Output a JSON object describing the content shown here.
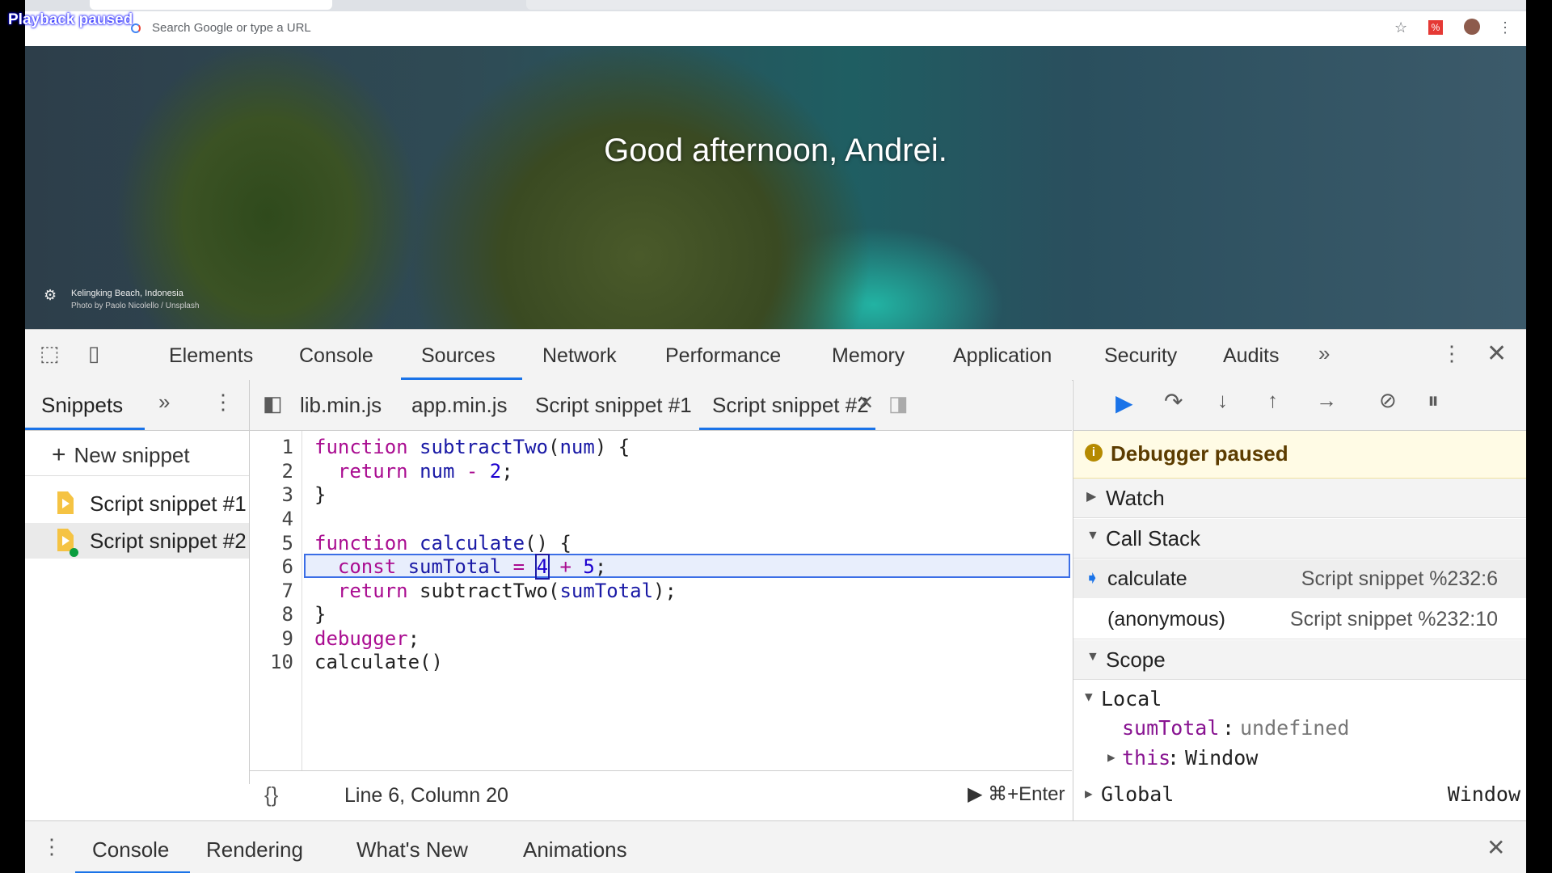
{
  "overlay": {
    "playback": "Playback paused"
  },
  "browser": {
    "url_placeholder": "Search Google or type a URL"
  },
  "hero": {
    "greeting": "Good afternoon, Andrei.",
    "location": "Kelingking Beach, Indonesia",
    "credit": "Photo by Paolo Nicolello / Unsplash"
  },
  "devtools": {
    "tabs": [
      "Elements",
      "Console",
      "Sources",
      "Network",
      "Performance",
      "Memory",
      "Application",
      "Security",
      "Audits"
    ],
    "active_tab": "Sources"
  },
  "navigator": {
    "tab": "Snippets",
    "new_snippet": "New snippet",
    "items": [
      "Script snippet #1",
      "Script snippet #2"
    ]
  },
  "editor": {
    "tabs": [
      "lib.min.js",
      "app.min.js",
      "Script snippet #1",
      "Script snippet #2"
    ],
    "active_tab": "Script snippet #2",
    "line_numbers": [
      "1",
      "2",
      "3",
      "4",
      "5",
      "6",
      "7",
      "8",
      "9",
      "10"
    ],
    "status": "Line 6, Column 20",
    "run_hint": "⌘+Enter"
  },
  "debugger": {
    "paused_message": "Debugger paused",
    "watch": "Watch",
    "call_stack": "Call Stack",
    "frames": [
      {
        "name": "calculate",
        "location": "Script snippet %232:6"
      },
      {
        "name": "(anonymous)",
        "location": "Script snippet %232:10"
      }
    ],
    "scope": "Scope",
    "local": "Local",
    "sumTotal_key": "sumTotal",
    "sumTotal_val": "undefined",
    "this_key": "this",
    "this_val": "Window",
    "global": "Global",
    "global_val": "Window"
  },
  "drawer": {
    "tabs": [
      "Console",
      "Rendering",
      "What's New",
      "Animations"
    ]
  },
  "colors": {
    "accent": "#1a73e8",
    "paused_bg": "#fffbe5",
    "keyword": "#aa0d91"
  }
}
